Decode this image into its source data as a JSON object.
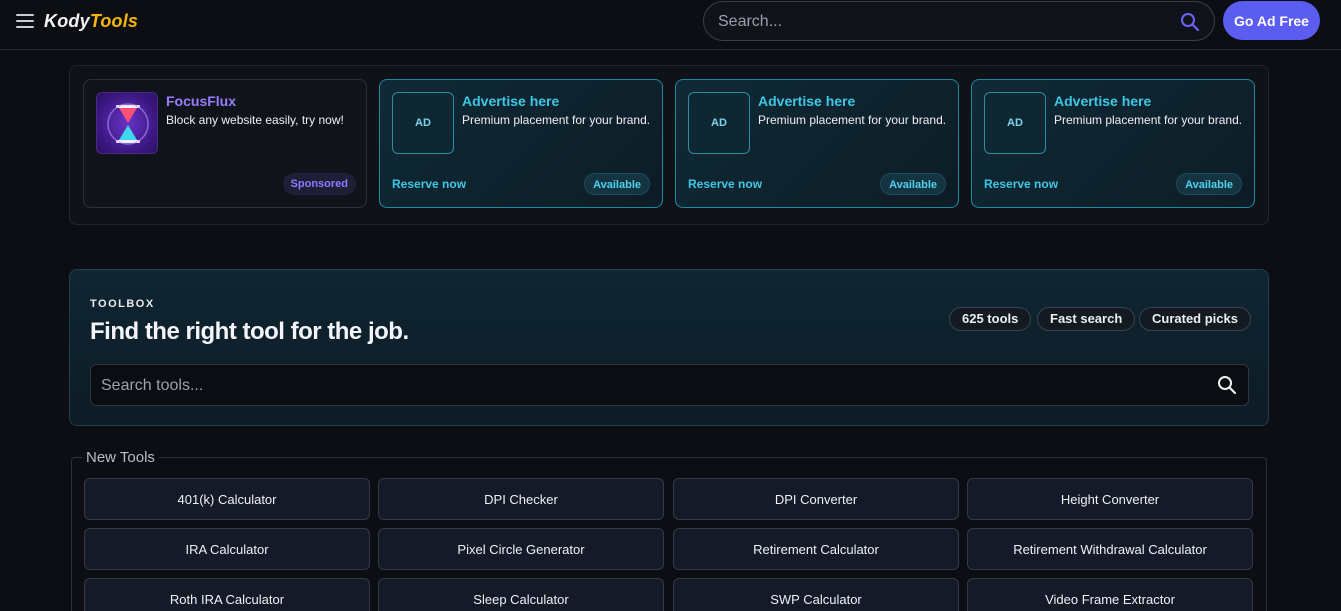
{
  "header": {
    "logo_primary": "Kody",
    "logo_accent": "Tools",
    "search_placeholder": "Search...",
    "go_ad_free_label": "Go Ad Free"
  },
  "ads": {
    "sponsored": {
      "title": "FocusFlux",
      "description": "Block any website easily, try now!",
      "badge": "Sponsored"
    },
    "slots": [
      {
        "thumb": "AD",
        "title": "Advertise here",
        "description": "Premium placement for your brand.",
        "link": "Reserve now",
        "badge": "Available"
      },
      {
        "thumb": "AD",
        "title": "Advertise here",
        "description": "Premium placement for your brand.",
        "link": "Reserve now",
        "badge": "Available"
      },
      {
        "thumb": "AD",
        "title": "Advertise here",
        "description": "Premium placement for your brand.",
        "link": "Reserve now",
        "badge": "Available"
      }
    ]
  },
  "toolbox": {
    "eyebrow": "TOOLBOX",
    "title": "Find the right tool for the job.",
    "pills": [
      "625 tools",
      "Fast search",
      "Curated picks"
    ],
    "search_placeholder": "Search tools..."
  },
  "new_tools": {
    "legend": "New Tools",
    "items": [
      "401(k) Calculator",
      "DPI Checker",
      "DPI Converter",
      "Height Converter",
      "IRA Calculator",
      "Pixel Circle Generator",
      "Retirement Calculator",
      "Retirement Withdrawal Calculator",
      "Roth IRA Calculator",
      "Sleep Calculator",
      "SWP Calculator",
      "Video Frame Extractor"
    ]
  },
  "colors": {
    "accent_purple": "#5b5cf0",
    "logo_accent": "#f2b705",
    "ad_cyan": "#3fc7e6"
  }
}
